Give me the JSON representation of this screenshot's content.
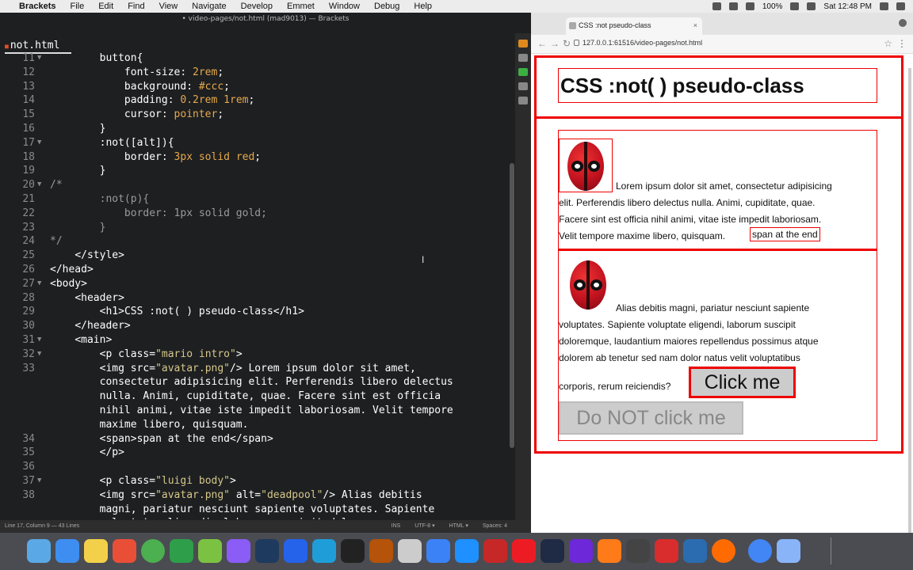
{
  "menubar": {
    "app_name": "Brackets",
    "items": [
      "File",
      "Edit",
      "Find",
      "View",
      "Navigate",
      "Develop",
      "Emmet",
      "Window",
      "Debug",
      "Help"
    ],
    "battery": "100%",
    "clock": "Sat 12:48 PM"
  },
  "editor": {
    "window_title": "• video-pages/not.html (mad9013) — Brackets",
    "tab_label": "not.html",
    "lines": [
      {
        "n": "11",
        "fold": "▼",
        "parts": [
          [
            "        ",
            ""
          ],
          [
            "button{",
            "c-sel"
          ]
        ]
      },
      {
        "n": "12",
        "fold": "",
        "parts": [
          [
            "            ",
            ""
          ],
          [
            "font-size: ",
            "c-prop"
          ],
          [
            "2rem",
            "c-num"
          ],
          [
            ";",
            "c-prop"
          ]
        ]
      },
      {
        "n": "13",
        "fold": "",
        "parts": [
          [
            "            ",
            ""
          ],
          [
            "background: ",
            "c-prop"
          ],
          [
            "#ccc",
            "c-val"
          ],
          [
            ";",
            "c-prop"
          ]
        ]
      },
      {
        "n": "14",
        "fold": "",
        "parts": [
          [
            "            ",
            ""
          ],
          [
            "padding: ",
            "c-prop"
          ],
          [
            "0.2rem 1rem",
            "c-num"
          ],
          [
            ";",
            "c-prop"
          ]
        ]
      },
      {
        "n": "15",
        "fold": "",
        "parts": [
          [
            "            ",
            ""
          ],
          [
            "cursor: ",
            "c-prop"
          ],
          [
            "pointer",
            "c-val"
          ],
          [
            ";",
            "c-prop"
          ]
        ]
      },
      {
        "n": "16",
        "fold": "",
        "parts": [
          [
            "        ",
            ""
          ],
          [
            "}",
            "c-sel"
          ]
        ]
      },
      {
        "n": "17",
        "fold": "▼",
        "parts": [
          [
            "        ",
            ""
          ],
          [
            ":not([alt]){",
            "c-sel"
          ]
        ]
      },
      {
        "n": "18",
        "fold": "",
        "parts": [
          [
            "            ",
            ""
          ],
          [
            "border: ",
            "c-prop"
          ],
          [
            "3px solid red",
            "c-val"
          ],
          [
            ";",
            "c-prop"
          ]
        ]
      },
      {
        "n": "19",
        "fold": "",
        "parts": [
          [
            "        ",
            ""
          ],
          [
            "}",
            "c-sel"
          ]
        ]
      },
      {
        "n": "20",
        "fold": "▼",
        "parts": [
          [
            "/*",
            "c-cmt"
          ]
        ]
      },
      {
        "n": "21",
        "fold": "",
        "parts": [
          [
            "        ",
            ""
          ],
          [
            ":not(p){",
            "c-cmt"
          ]
        ]
      },
      {
        "n": "22",
        "fold": "",
        "parts": [
          [
            "            ",
            ""
          ],
          [
            "border: 1px solid gold;",
            "c-cmt"
          ]
        ]
      },
      {
        "n": "23",
        "fold": "",
        "parts": [
          [
            "        ",
            ""
          ],
          [
            "}",
            "c-cmt"
          ]
        ]
      },
      {
        "n": "24",
        "fold": "",
        "parts": [
          [
            "*/",
            "c-cmt"
          ]
        ]
      },
      {
        "n": "25",
        "fold": "",
        "parts": [
          [
            "    ",
            ""
          ],
          [
            "</style>",
            "c-tag"
          ]
        ]
      },
      {
        "n": "26",
        "fold": "",
        "parts": [
          [
            "</head>",
            "c-tag"
          ]
        ]
      },
      {
        "n": "27",
        "fold": "▼",
        "parts": [
          [
            "<body>",
            "c-tag"
          ]
        ]
      },
      {
        "n": "28",
        "fold": "",
        "parts": [
          [
            "    ",
            ""
          ],
          [
            "<header>",
            "c-tag"
          ]
        ]
      },
      {
        "n": "29",
        "fold": "",
        "parts": [
          [
            "        ",
            ""
          ],
          [
            "<h1>",
            "c-tag"
          ],
          [
            "CSS :not( ) pseudo-class",
            "c-tag"
          ],
          [
            "</h1>",
            "c-tag"
          ]
        ]
      },
      {
        "n": "30",
        "fold": "",
        "parts": [
          [
            "    ",
            ""
          ],
          [
            "</header>",
            "c-tag"
          ]
        ]
      },
      {
        "n": "31",
        "fold": "▼",
        "parts": [
          [
            "    ",
            ""
          ],
          [
            "<main>",
            "c-tag"
          ]
        ]
      },
      {
        "n": "32",
        "fold": "▼",
        "parts": [
          [
            "        ",
            ""
          ],
          [
            "<p ",
            "c-tag"
          ],
          [
            "class=",
            "c-tag"
          ],
          [
            "\"mario intro\"",
            "c-str"
          ],
          [
            ">",
            "c-tag"
          ]
        ]
      },
      {
        "n": "33",
        "fold": "",
        "parts": [
          [
            "        ",
            ""
          ],
          [
            "<img ",
            "c-tag"
          ],
          [
            "src=",
            "c-tag"
          ],
          [
            "\"avatar.png\"",
            "c-str"
          ],
          [
            "/> Lorem ipsum dolor sit amet,",
            "c-tag"
          ]
        ]
      },
      {
        "n": "",
        "fold": "",
        "parts": [
          [
            "        ",
            ""
          ],
          [
            "consectetur adipisicing elit. Perferendis libero delectus",
            "c-tag"
          ]
        ]
      },
      {
        "n": "",
        "fold": "",
        "parts": [
          [
            "        ",
            ""
          ],
          [
            "nulla. Animi, cupiditate, quae. Facere sint est officia",
            "c-tag"
          ]
        ]
      },
      {
        "n": "",
        "fold": "",
        "parts": [
          [
            "        ",
            ""
          ],
          [
            "nihil animi, vitae iste impedit laboriosam. Velit tempore",
            "c-tag"
          ]
        ]
      },
      {
        "n": "",
        "fold": "",
        "parts": [
          [
            "        ",
            ""
          ],
          [
            "maxime libero, quisquam.",
            "c-tag"
          ]
        ]
      },
      {
        "n": "34",
        "fold": "",
        "parts": [
          [
            "        ",
            ""
          ],
          [
            "<span>",
            "c-tag"
          ],
          [
            "span at the end",
            "c-tag"
          ],
          [
            "</span>",
            "c-tag"
          ]
        ]
      },
      {
        "n": "35",
        "fold": "",
        "parts": [
          [
            "        ",
            ""
          ],
          [
            "</p>",
            "c-tag"
          ]
        ]
      },
      {
        "n": "36",
        "fold": "",
        "parts": [
          [
            "",
            ""
          ]
        ]
      },
      {
        "n": "37",
        "fold": "▼",
        "parts": [
          [
            "        ",
            ""
          ],
          [
            "<p ",
            "c-tag"
          ],
          [
            "class=",
            "c-tag"
          ],
          [
            "\"luigi body\"",
            "c-str"
          ],
          [
            ">",
            "c-tag"
          ]
        ]
      },
      {
        "n": "38",
        "fold": "",
        "parts": [
          [
            "        ",
            ""
          ],
          [
            "<img ",
            "c-tag"
          ],
          [
            "src=",
            "c-tag"
          ],
          [
            "\"avatar.png\"",
            "c-str"
          ],
          [
            " alt=",
            "c-tag"
          ],
          [
            "\"deadpool\"",
            "c-str"
          ],
          [
            "/> Alias debitis",
            "c-tag"
          ]
        ]
      },
      {
        "n": "",
        "fold": "",
        "parts": [
          [
            "        ",
            ""
          ],
          [
            "magni, pariatur nesciunt sapiente voluptates. Sapiente",
            "c-tag"
          ]
        ]
      },
      {
        "n": "",
        "fold": "",
        "parts": [
          [
            "        ",
            ""
          ],
          [
            "voluptate eligendi, laborum suscipit doloremque,",
            "c-tag"
          ]
        ]
      }
    ],
    "status": {
      "position": "Line 17, Column 9 — 43 Lines",
      "mode": "INS",
      "encoding": "UTF-8 ▾",
      "language": "HTML ▾",
      "spaces": "Spaces: 4"
    }
  },
  "browser": {
    "tab_title": "CSS :not pseudo-class",
    "url": "127.0.0.1:61516/video-pages/not.html",
    "page": {
      "h1": "CSS :not( ) pseudo-class",
      "p1_lines": [
        "Lorem ipsum dolor sit amet, consectetur adipisicing",
        "elit. Perferendis libero delectus nulla. Animi, cupiditate, quae.",
        "Facere sint est officia nihil animi, vitae iste impedit laboriosam.",
        "Velit tempore maxime libero, quisquam."
      ],
      "span_end": "span at the end",
      "p2_lines": [
        "Alias debitis magni, pariatur nesciunt sapiente",
        "voluptates. Sapiente voluptate eligendi, laborum suscipit",
        "doloremque, laudantium maiores repellendus possimus atque",
        "dolorem ab tenetur sed nam dolor natus velit voluptatibus",
        "corporis, rerum reiciendis?"
      ],
      "button_click": "Click me",
      "button_dont": "Do NOT click me"
    }
  },
  "dock": {
    "colors": [
      "#5aa9e6",
      "#3d8ef0",
      "#f3d04a",
      "#e94f37",
      "#4caf50",
      "#2e9e4a",
      "#7cc242",
      "#8b5cf6",
      "#1e3a5f",
      "#2563eb",
      "#1f9dd9",
      "#222222",
      "#b45309",
      "#cccccc",
      "#3b82f6",
      "#1e90ff",
      "#c62828",
      "#ed1c24",
      "#1f2a44",
      "#6d28d9",
      "#ff7a18",
      "#444444",
      "#d92d2d",
      "#2b6cb0",
      "#ff6b00",
      "#4285f4",
      "#8ab4f8"
    ]
  }
}
